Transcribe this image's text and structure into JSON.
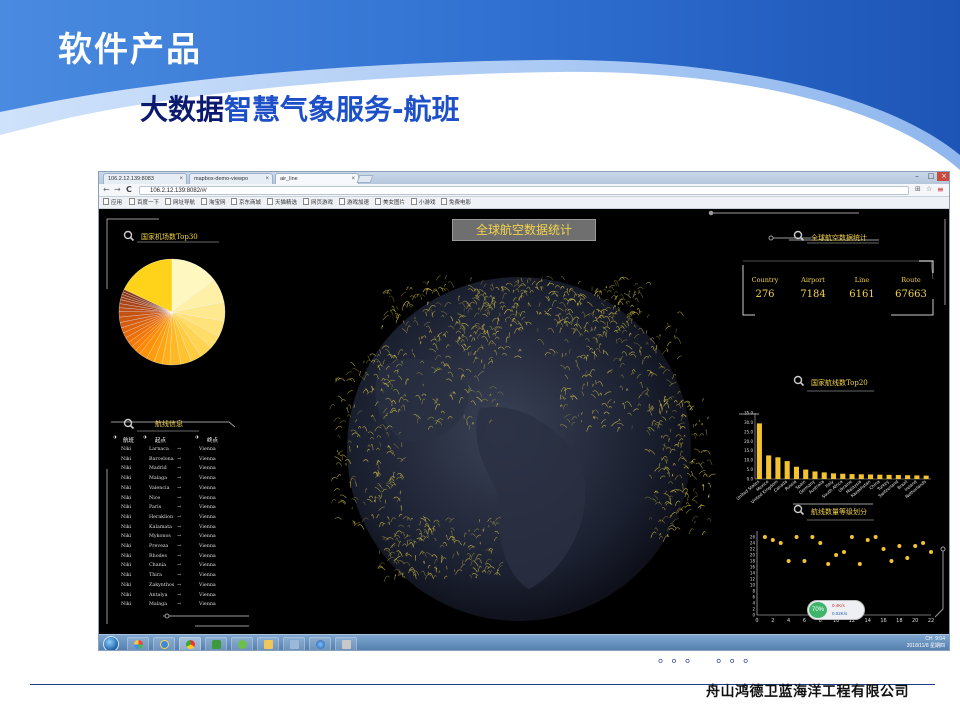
{
  "slide": {
    "section_title": "软件产品",
    "title_part1": "大数据",
    "title_part2": "智慧气象服务-航班",
    "footer_company": "舟山鸿德卫蓝海洋工程有限公司",
    "dots": "。。。 。。。"
  },
  "colors": {
    "banner_blue": "#2f6fd0",
    "accent_yellow": "#f2d34b",
    "title_dark": "#0b1a6e",
    "title_blue": "#1d4fc9"
  },
  "browser": {
    "tabs": [
      {
        "label": "106.2.12.139:8083"
      },
      {
        "label": "mapbox-demo-viewpo"
      },
      {
        "label": "air_line"
      }
    ],
    "url": "106.2.12.139:8082/#/",
    "bookmarks": [
      "应用",
      "百度一下",
      "网址导航",
      "淘宝网",
      "京东商城",
      "天猫精选",
      "网页游戏",
      "游戏加速",
      "美女图片",
      "小游戏",
      "免费电影"
    ]
  },
  "dashboard": {
    "center_title": "全球航空数据统计",
    "pie_title": "国家机场数Top30",
    "stats_title": "全球航空数据统计",
    "stats": [
      {
        "label": "Country",
        "value": "276"
      },
      {
        "label": "Airport",
        "value": "7184"
      },
      {
        "label": "Line",
        "value": "6161"
      },
      {
        "label": "Route",
        "value": "67663"
      }
    ],
    "flight_title": "航线信息",
    "flight_headers": {
      "airline": "航班",
      "from": "起点",
      "to": "终点"
    },
    "flights": [
      {
        "airline": "Niki",
        "from": "Larnaca",
        "to": "Vienna"
      },
      {
        "airline": "Niki",
        "from": "Barcelona",
        "to": "Vienna"
      },
      {
        "airline": "Niki",
        "from": "Madrid",
        "to": "Vienna"
      },
      {
        "airline": "Niki",
        "from": "Malaga",
        "to": "Vienna"
      },
      {
        "airline": "Niki",
        "from": "Valencia",
        "to": "Vienna"
      },
      {
        "airline": "Niki",
        "from": "Nice",
        "to": "Vienna"
      },
      {
        "airline": "Niki",
        "from": "Paris",
        "to": "Vienna"
      },
      {
        "airline": "Niki",
        "from": "Heraklion",
        "to": "Vienna"
      },
      {
        "airline": "Niki",
        "from": "Kalamata",
        "to": "Vienna"
      },
      {
        "airline": "Niki",
        "from": "Mykonos",
        "to": "Vienna"
      },
      {
        "airline": "Niki",
        "from": "Preveza",
        "to": "Vienna"
      },
      {
        "airline": "Niki",
        "from": "Rhodes",
        "to": "Vienna"
      },
      {
        "airline": "Niki",
        "from": "Chania",
        "to": "Vienna"
      },
      {
        "airline": "Niki",
        "from": "Thira",
        "to": "Vienna"
      },
      {
        "airline": "Niki",
        "from": "Zakynthos",
        "to": "Vienna"
      },
      {
        "airline": "Niki",
        "from": "Antalya",
        "to": "Vienna"
      },
      {
        "airline": "Niki",
        "from": "Malaga",
        "to": "Vienna"
      }
    ],
    "arrow": "→",
    "bar_title": "国家航线数Top20",
    "scatter_title": "航线数量等级划分",
    "speed_badge": "70%",
    "speed_up": "0.4K/s",
    "speed_down": "0.02K/s"
  },
  "taskbar": {
    "lang": "CH",
    "time": "9:04",
    "date": "2018/11/8 星期四"
  },
  "chart_data": [
    {
      "type": "pie",
      "title": "国家机场数Top30",
      "values": [
        18,
        9,
        7,
        6,
        5,
        5,
        4,
        4,
        4,
        3,
        3,
        3,
        3,
        2,
        2,
        2,
        2,
        2,
        2,
        2,
        2,
        2,
        1.5,
        1.5,
        1.5,
        1,
        1,
        1,
        1,
        22
      ],
      "colors": [
        "#fff7c0",
        "#fff0a8",
        "#ffe98f",
        "#ffe27a",
        "#ffdc66",
        "#ffd452",
        "#ffcc40",
        "#ffc330",
        "#ffb924",
        "#ffaf1a",
        "#ffa512",
        "#ff9b0c",
        "#ff9108",
        "#ff8806",
        "#fb7f06",
        "#f57707",
        "#ee7009",
        "#e6690b",
        "#de630d",
        "#d65d0f",
        "#cd5711",
        "#c45213",
        "#bb4d15",
        "#b14917",
        "#a84518",
        "#9f411a",
        "#963d1b",
        "#8d3a1c",
        "#85371d",
        "#ffd31a"
      ]
    },
    {
      "type": "bar",
      "title": "国家航线数Top20",
      "categories": [
        "United States",
        "Mexico",
        "United Kingdom",
        "Canada",
        "Russia",
        "Spain",
        "Germany",
        "Australia",
        "Italy",
        "South Africa",
        "Ukraine",
        "Malaysia",
        "Kazakhstan",
        "China",
        "Turkey",
        "Switzerland",
        "Brazil",
        "Ireland",
        "Netherlands"
      ],
      "values": [
        29.5,
        12.5,
        11.5,
        9.5,
        6.5,
        5.0,
        4.0,
        3.5,
        3.0,
        2.8,
        2.6,
        2.5,
        2.4,
        2.3,
        2.2,
        2.1,
        2.0,
        1.9,
        1.8
      ],
      "yticks": [
        "0.0",
        "5.0",
        "10.0",
        "15.0",
        "20.0",
        "25.0",
        "30.0",
        "35.0"
      ],
      "ylim": [
        0,
        35
      ]
    },
    {
      "type": "scatter",
      "title": "航线数量等级划分",
      "x": [
        1,
        2,
        3,
        4,
        5,
        6,
        7,
        8,
        9,
        10,
        11,
        12,
        13,
        14,
        15,
        16,
        17,
        18,
        19,
        20,
        21,
        22
      ],
      "y": [
        26,
        25,
        24,
        18,
        26,
        18,
        26,
        24,
        17,
        20,
        21,
        26,
        17,
        25,
        26,
        22,
        18,
        23,
        19,
        23,
        24,
        21
      ],
      "xticks": [
        "0",
        "2",
        "4",
        "6",
        "8",
        "10",
        "12",
        "14",
        "16",
        "18",
        "20",
        "22"
      ],
      "yticks": [
        "0",
        "2",
        "4",
        "6",
        "8",
        "10",
        "12",
        "14",
        "16",
        "18",
        "20",
        "22",
        "24",
        "26"
      ],
      "xlim": [
        0,
        22
      ],
      "ylim": [
        0,
        28
      ]
    }
  ]
}
